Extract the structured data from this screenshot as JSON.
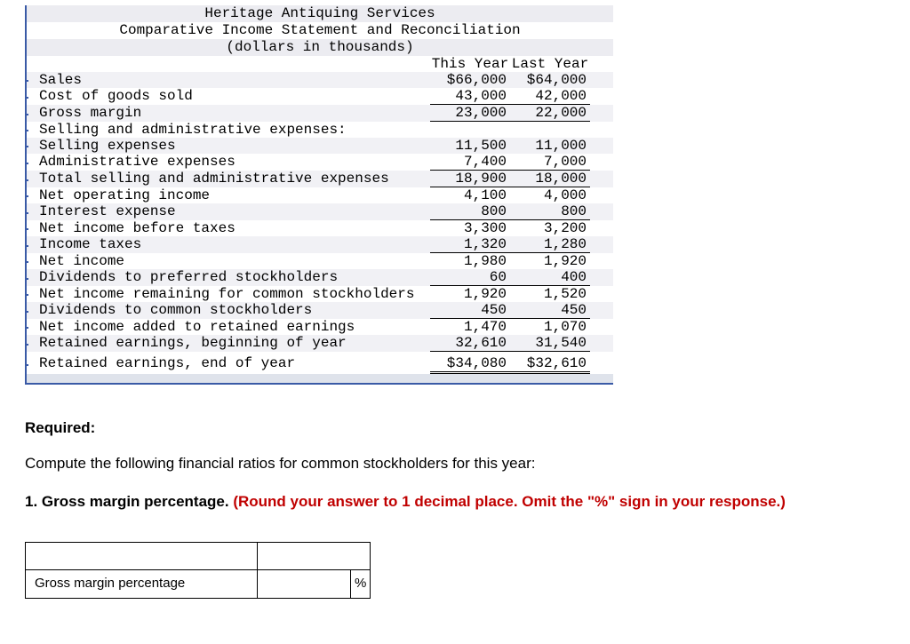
{
  "statement": {
    "title_line1": "Heritage Antiquing Services",
    "title_line2": "Comparative Income Statement and Reconciliation",
    "title_line3": "(dollars in thousands)",
    "col_headers": [
      "This Year",
      "Last Year"
    ],
    "rows": [
      {
        "label": "Sales",
        "ty": "$66,000",
        "ly": "$64,000",
        "ul": false
      },
      {
        "label": "Cost of goods sold",
        "ty": "43,000",
        "ly": "42,000",
        "ul": true
      },
      {
        "label": "Gross margin",
        "ty": "23,000",
        "ly": "22,000",
        "ul": true
      },
      {
        "label": "Selling and administrative expenses:",
        "ty": "",
        "ly": "",
        "ul": false
      },
      {
        "label": "Selling expenses",
        "ty": "11,500",
        "ly": "11,000",
        "ul": false
      },
      {
        "label": "Administrative expenses",
        "ty": "7,400",
        "ly": "7,000",
        "ul": true
      },
      {
        "label": "Total selling and administrative expenses",
        "ty": "18,900",
        "ly": "18,000",
        "ul": true
      },
      {
        "label": "Net operating income",
        "ty": "4,100",
        "ly": "4,000",
        "ul": false
      },
      {
        "label": "Interest expense",
        "ty": "800",
        "ly": "800",
        "ul": true
      },
      {
        "label": "Net income before taxes",
        "ty": "3,300",
        "ly": "3,200",
        "ul": false
      },
      {
        "label": "Income taxes",
        "ty": "1,320",
        "ly": "1,280",
        "ul": true
      },
      {
        "label": "Net income",
        "ty": "1,980",
        "ly": "1,920",
        "ul": false
      },
      {
        "label": "Dividends to preferred stockholders",
        "ty": "60",
        "ly": "400",
        "ul": true
      },
      {
        "label": "Net income remaining for common stockholders",
        "ty": "1,920",
        "ly": "1,520",
        "ul": false
      },
      {
        "label": "Dividends to common stockholders",
        "ty": "450",
        "ly": "450",
        "ul": true
      },
      {
        "label": "Net income added to retained earnings",
        "ty": "1,470",
        "ly": "1,070",
        "ul": false
      },
      {
        "label": "Retained earnings, beginning of year",
        "ty": "32,610",
        "ly": "31,540",
        "ul": true
      },
      {
        "label": "Retained earnings, end of year",
        "ty": "$34,080",
        "ly": "$32,610",
        "ul": false,
        "dbl": true
      }
    ]
  },
  "question": {
    "required": "Required:",
    "prompt": "Compute the following financial ratios for common stockholders for this year:",
    "item_num": "1. ",
    "item_label": "Gross margin percentage. ",
    "item_instruction": "(Round your answer to 1 decimal place. Omit the \"%\" sign in your response.)"
  },
  "answer_table": {
    "row_label": "Gross margin percentage",
    "unit": "%",
    "value": ""
  }
}
